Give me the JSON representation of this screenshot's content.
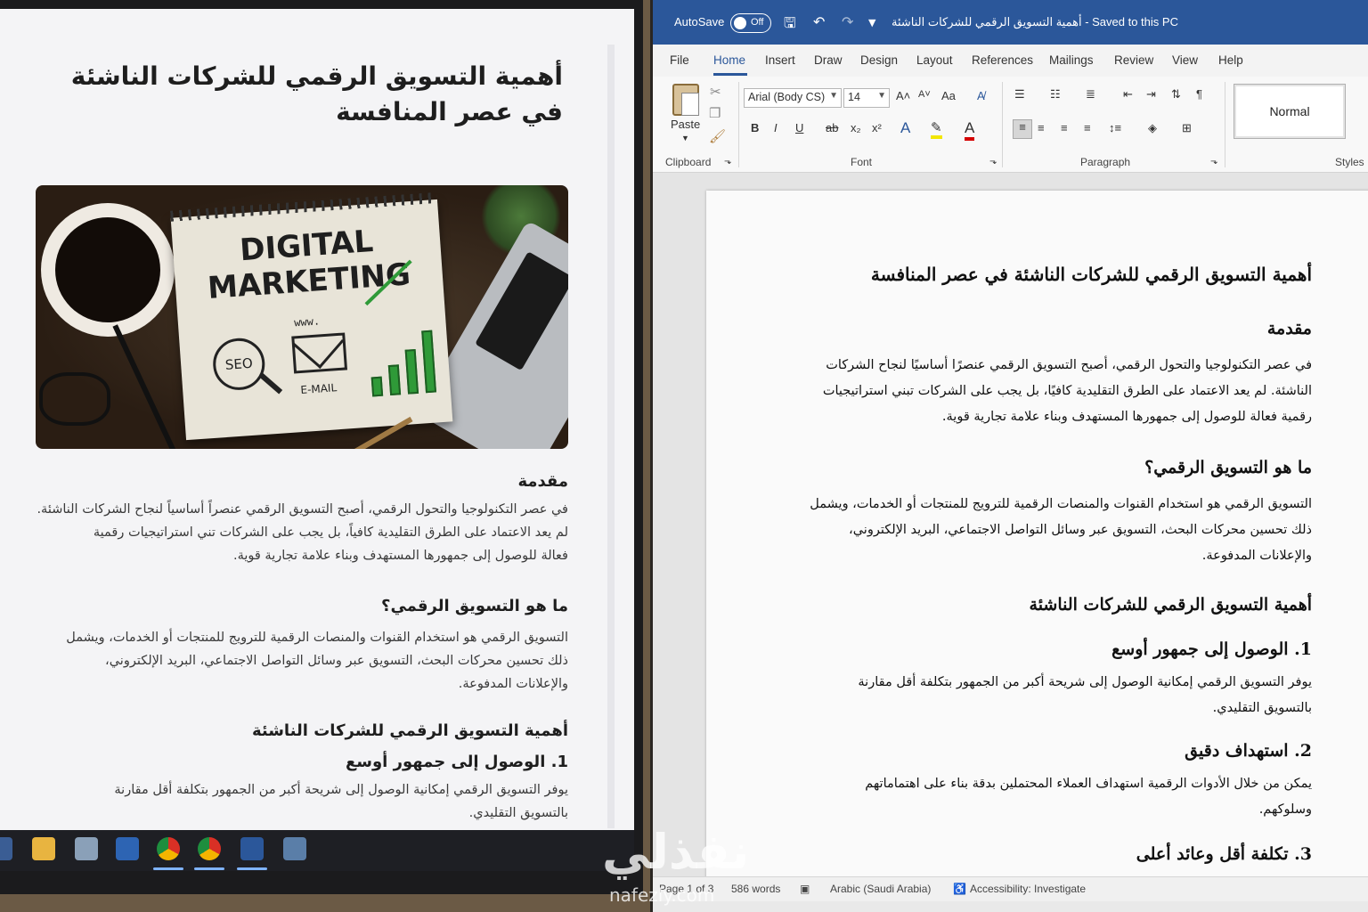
{
  "left": {
    "title": "أهمية التسويق الرقمي للشركات الناشئة في عصر المنافسة",
    "hero": {
      "line1": "DIGITAL",
      "line2": "MARKETING",
      "www": "www.",
      "seo": "SEO",
      "email": "E-MAIL"
    },
    "intro_heading": "مقدمة",
    "intro_lines": [
      "في عصر التكنولوجيا والتحول الرقمي، أصبح التسويق الرقمي عنصراً أساسياً لنجاح الشركات الناشئة.",
      "لم يعد الاعتماد على الطرق التقليدية كافياً، بل يجب على الشركات تني استراتيجيات رقمية",
      "فعالة للوصول إلى جمهورها المستهدف وبناء علامة تجارية قوية."
    ],
    "what_heading": "ما هو التسويق الرقمي؟",
    "what_lines": [
      "التسويق الرقمي هو استخدام القنوات والمنصات الرقمية للترويج للمنتجات أو الخدمات، ويشمل",
      "ذلك تحسين محركات البحث، التسويق عبر وسائل التواصل الاجتماعي، البريد الإلكتروني،",
      "والإعلانات المدفوعة."
    ],
    "importance_heading": "أهمية التسويق الرقمي للشركات الناشئة",
    "point1_heading": "1. الوصول إلى جمهور أوسع",
    "point1_lines": [
      "يوفر التسويق الرقمي إمكانية الوصول إلى شريحة أكبر من الجمهور بتكلفة أقل مقارنة",
      "بالتسويق التقليدي."
    ]
  },
  "word": {
    "autosave_label": "AutoSave",
    "autosave_state": "Off",
    "doc_title": "أهمية التسويق الرقمي للشركات الناشئة  -  Saved to this PC",
    "tabs": [
      "File",
      "Home",
      "Insert",
      "Draw",
      "Design",
      "Layout",
      "References",
      "Mailings",
      "Review",
      "View",
      "Help"
    ],
    "active_tab": "Home",
    "ribbon": {
      "paste_label": "Paste",
      "clipboard_label": "Clipboard",
      "font_name": "Arial (Body CS)",
      "font_size": "14",
      "font_label": "Font",
      "paragraph_label": "Paragraph",
      "style_normal": "Normal",
      "styles_label": "Styles"
    },
    "doc": {
      "title": "أهمية التسويق الرقمي للشركات الناشئة في عصر المنافسة",
      "intro_heading": "مقدمة",
      "intro_lines": [
        "في عصر التكنولوجيا والتحول الرقمي، أصبح التسويق الرقمي عنصرًا أساسيًا لنجاح الشركات",
        "الناشئة. لم يعد الاعتماد على الطرق التقليدية كافيًا، بل يجب على الشركات تبني استراتيجيات",
        "رقمية فعالة للوصول إلى جمهورها المستهدف وبناء علامة تجارية قوية."
      ],
      "what_heading": "ما هو التسويق الرقمي؟",
      "what_lines": [
        "التسويق الرقمي هو استخدام القنوات والمنصات الرقمية للترويج للمنتجات أو الخدمات، ويشمل",
        "ذلك تحسين محركات البحث، التسويق عبر وسائل التواصل الاجتماعي، البريد الإلكتروني،",
        "والإعلانات المدفوعة."
      ],
      "importance_heading": "أهمية التسويق الرقمي للشركات الناشئة",
      "point1_heading": "1. الوصول إلى جمهور أوسع",
      "point1_lines": [
        "يوفر التسويق الرقمي إمكانية الوصول إلى شريحة أكبر من الجمهور بتكلفة أقل مقارنة",
        "بالتسويق التقليدي."
      ],
      "point2_heading": "2. استهداف دقيق",
      "point2_lines": [
        "يمكن من خلال الأدوات الرقمية استهداف العملاء المحتملين بدقة بناء على اهتماماتهم",
        "وسلوكهم."
      ],
      "point3_heading": "3. تكلفة أقل وعائد أعلى"
    },
    "status": {
      "page": "Page 1 of 3",
      "words": "586 words",
      "language": "Arabic (Saudi Arabia)",
      "accessibility": "Accessibility: Investigate"
    }
  },
  "watermark": {
    "arabic": "نفذلي",
    "latin": "nafezly.com"
  },
  "colors": {
    "word_blue": "#2b579a",
    "chart_green": "#2f9a38"
  }
}
